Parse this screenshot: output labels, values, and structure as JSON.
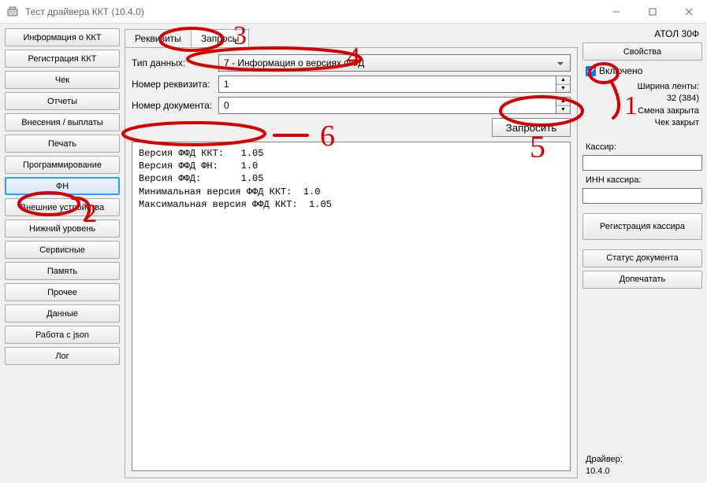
{
  "window": {
    "title": "Тест драйвера ККТ (10.4.0)"
  },
  "sidebar": {
    "items": [
      "Информация о ККТ",
      "Регистрация ККТ",
      "Чек",
      "Отчеты",
      "Внесения / выплаты",
      "Печать",
      "Программирование",
      "ФН",
      "Внешние устройства",
      "Нижний уровень",
      "Сервисные",
      "Память",
      "Прочее",
      "Данные",
      "Работа с json",
      "Лог"
    ],
    "active_index": 7
  },
  "tabs": {
    "items": [
      "Реквизиты",
      "Запросы"
    ],
    "active_index": 1
  },
  "form": {
    "type_label": "Тип данных:",
    "type_value": "7 - Информация о версиях ФФД",
    "req_label": "Номер реквизита:",
    "req_value": "1",
    "doc_label": "Номер документа:",
    "doc_value": "0",
    "request_btn": "Запросить"
  },
  "output_lines": [
    "Версия ФФД ККТ:   1.05",
    "Версия ФФД ФН:    1.0",
    "Версия ФФД:       1.05",
    "Минимальная версия ФФД ККТ:  1.0",
    "Максимальная версия ФФД ККТ:  1.05"
  ],
  "right": {
    "device": "АТОЛ 30Ф",
    "props_btn": "Свойства",
    "enabled_label": "Включено",
    "tape_label": "Ширина ленты:",
    "tape_value": "32 (384)",
    "shift_status": "Смена закрыта",
    "receipt_status": "Чек закрыт",
    "cashier_label": "Кассир:",
    "cashier_value": "",
    "inn_label": "ИНН кассира:",
    "inn_value": "",
    "reg_btn": "Регистрация кассира",
    "docstatus_btn": "Статус документа",
    "reprint_btn": "Допечатать",
    "drv_label": "Драйвер:",
    "drv_value": "10.4.0"
  },
  "annotations": {
    "color": "#d40000",
    "marks": [
      "1",
      "2",
      "3",
      "4",
      "5",
      "6"
    ]
  }
}
